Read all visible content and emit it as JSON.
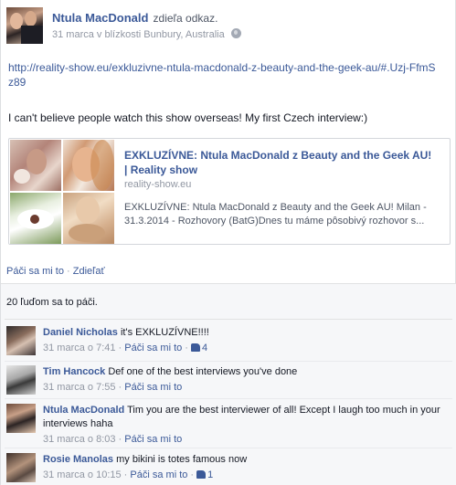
{
  "post": {
    "author": "Ntula MacDonald",
    "action": "zdieľa odkaz.",
    "date": "31 marca v blízkosti",
    "location": "Bunbury, Australia",
    "url": "http://reality-show.eu/exkluzivne-ntula-macdonald-z-beauty-and-the-geek-au/#.Uzj-FfmSz89",
    "message": "I can't believe people watch this show overseas! My first Czech interview:)"
  },
  "share_card": {
    "title": "EXKLUZÍVNE: Ntula MacDonald z Beauty and the Geek AU! | Reality show",
    "domain": "reality-show.eu",
    "description": "EXKLUZÍVNE: Ntula MacDonald z Beauty and the Geek AU! Milan - 31.3.2014 - Rozhovory (BatG)Dnes tu máme pôsobivý rozhovor s..."
  },
  "actions": {
    "like": "Páči sa mi to",
    "separator": "·",
    "share": "Zdieľať"
  },
  "likes_summary": "20 ľuďom sa to páči.",
  "comments": [
    {
      "author": "Daniel Nicholas",
      "text": "it's EXKLUZÍVNE!!!!",
      "time": "31 marca o 7:41",
      "like_label": "Páči sa mi to",
      "like_count": "4"
    },
    {
      "author": "Tim Hancock",
      "text": "Def one of the best interviews you've done",
      "time": "31 marca o 7:55",
      "like_label": "Páči sa mi to",
      "like_count": ""
    },
    {
      "author": "Ntula MacDonald",
      "text": "Tim you are the best interviewer of all! Except I laugh too much in your interviews haha",
      "time": "31 marca o 8:03",
      "like_label": "Páči sa mi to",
      "like_count": ""
    },
    {
      "author": "Rosie Manolas",
      "text": "my bikini is totes famous now",
      "time": "31 marca o 10:15",
      "like_label": "Páči sa mi to",
      "like_count": "1"
    }
  ],
  "colors": {
    "link": "#3b5998",
    "meta": "#9197a3",
    "ufi_background": "#f6f7f9"
  }
}
